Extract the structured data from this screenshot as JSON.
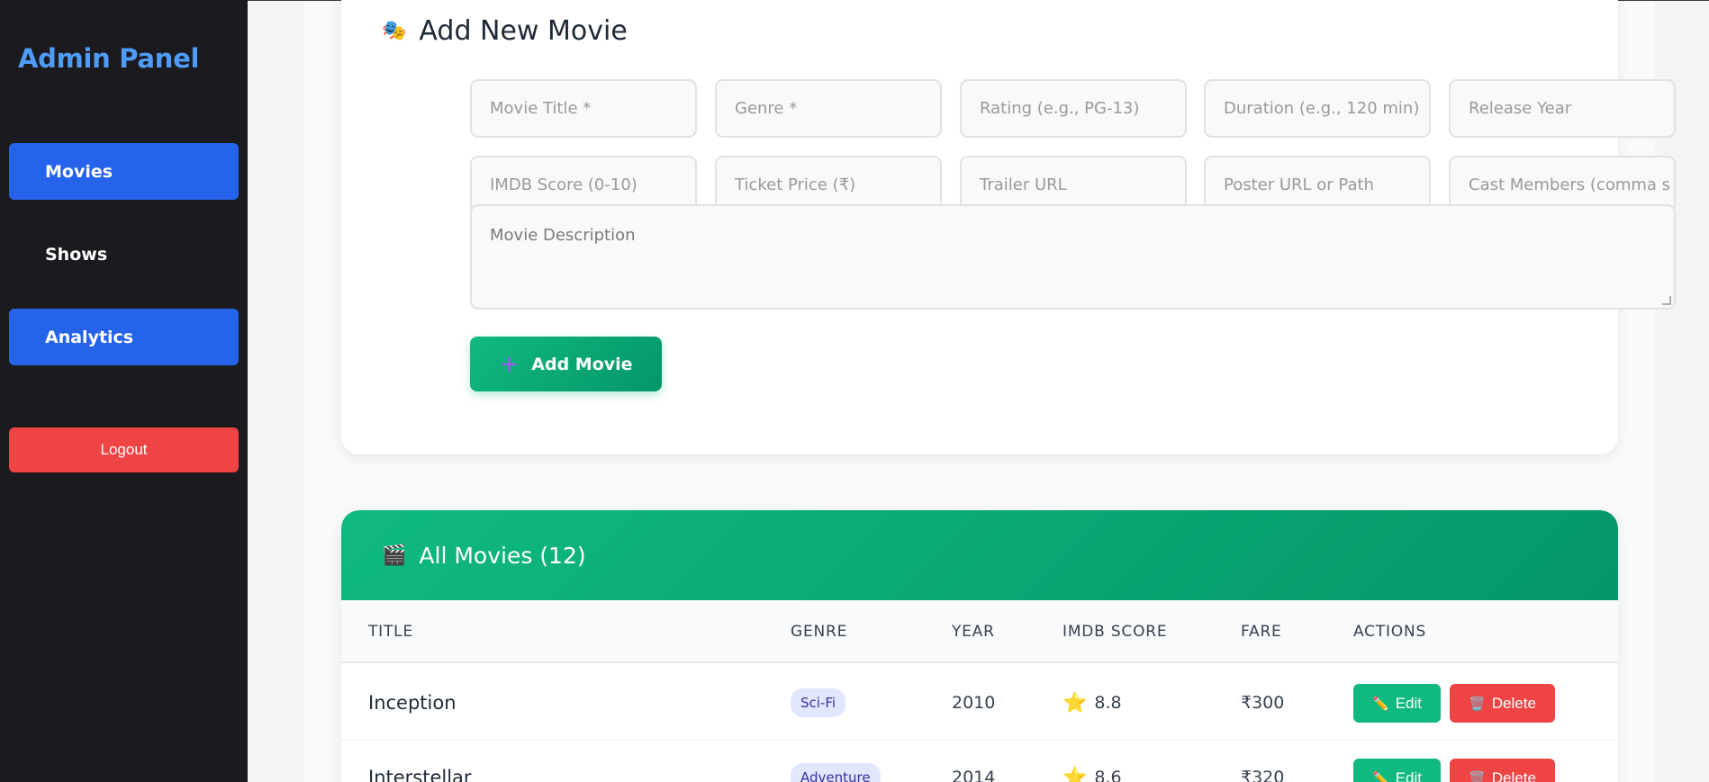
{
  "sidebar": {
    "brand": "Admin Panel",
    "items": [
      {
        "label": "Movies",
        "active": true
      },
      {
        "label": "Shows",
        "active": false
      },
      {
        "label": "Analytics",
        "active": true
      }
    ],
    "logout_label": "Logout"
  },
  "form": {
    "title": "Add New Movie",
    "title_icon": "🎭",
    "fields": [
      {
        "placeholder": "Movie Title *"
      },
      {
        "placeholder": "Genre *"
      },
      {
        "placeholder": "Rating (e.g., PG-13)"
      },
      {
        "placeholder": "Duration (e.g., 120 min)"
      },
      {
        "placeholder": "Release Year"
      },
      {
        "placeholder": "IMDB Score (0-10)"
      },
      {
        "placeholder": "Ticket Price (₹)"
      },
      {
        "placeholder": "Trailer URL"
      },
      {
        "placeholder": "Poster URL or Path"
      },
      {
        "placeholder": "Cast Members (comma s"
      }
    ],
    "description_placeholder": "Movie Description",
    "submit_icon": "+",
    "submit_label": "Add Movie"
  },
  "table": {
    "title": "All Movies (12)",
    "title_icon": "🎬",
    "columns": [
      "TITLE",
      "GENRE",
      "YEAR",
      "IMDB SCORE",
      "FARE",
      "ACTIONS"
    ],
    "rows": [
      {
        "title": "Inception",
        "genre": "Sci-Fi",
        "year": "2010",
        "score": "8.8",
        "fare": "₹300"
      },
      {
        "title": "Interstellar",
        "genre": "Adventure",
        "year": "2014",
        "score": "8.6",
        "fare": "₹320"
      }
    ],
    "star_icon": "⭐",
    "edit_icon": "✏️",
    "edit_label": "Edit",
    "delete_icon": "🗑️",
    "delete_label": "Delete"
  },
  "colors": {
    "sidebar_bg": "#1b1b1f",
    "brand": "#4f9cf7",
    "nav_active": "#2563eb",
    "danger": "#ef4444",
    "success": "#10b981"
  }
}
